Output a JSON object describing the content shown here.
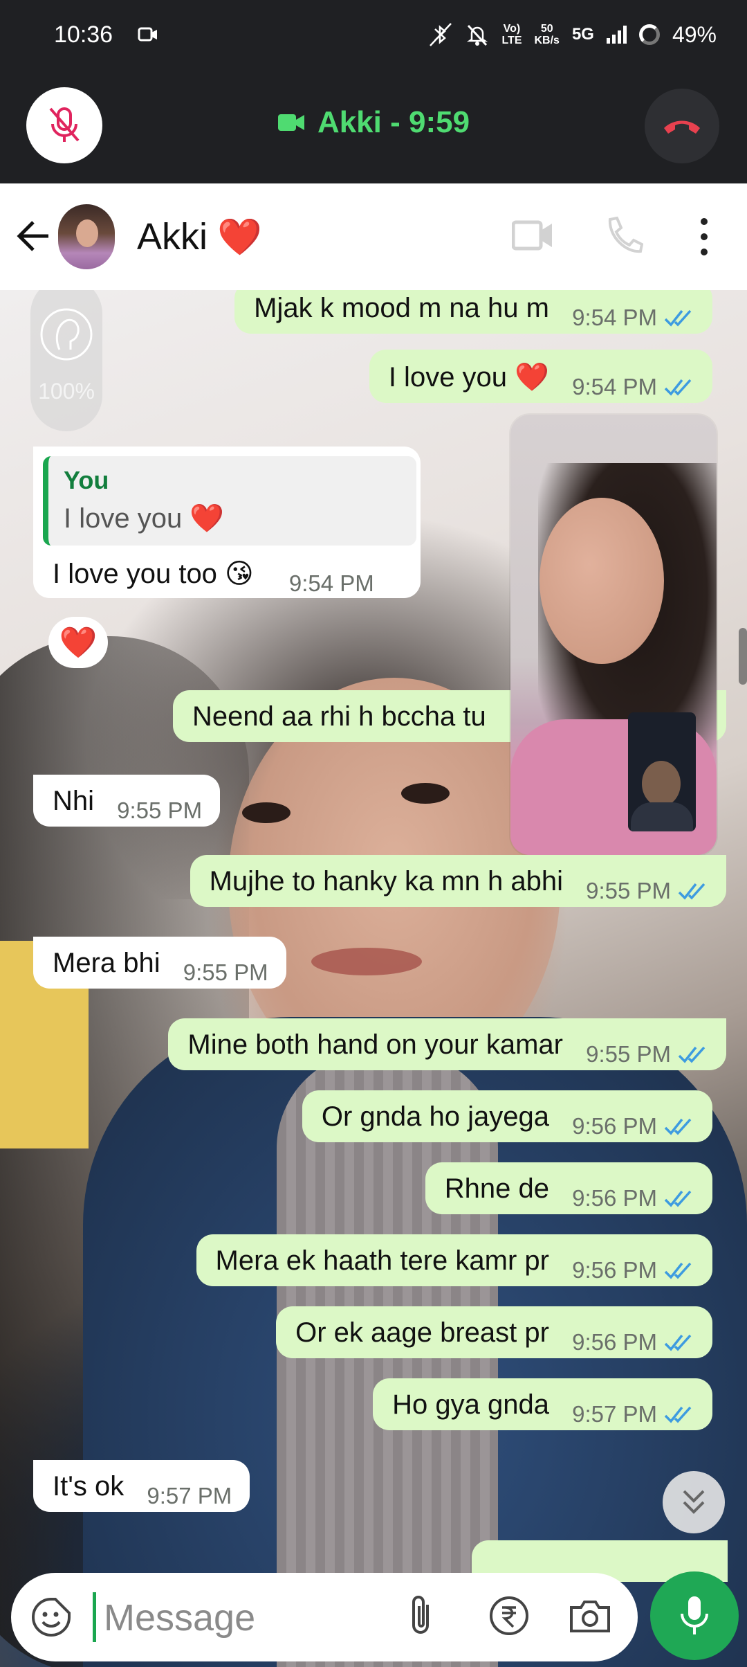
{
  "status_bar": {
    "time": "10:36",
    "net_speed_value": "50",
    "net_speed_unit": "KB/s",
    "volte_top": "Vo)",
    "volte_bottom": "LTE",
    "network": "5G",
    "battery": "49%"
  },
  "call_bar": {
    "title": "Akki - 9:59"
  },
  "header": {
    "contact_name": "Akki",
    "name_emoji": "❤️"
  },
  "eye_comfort": {
    "level": "100%"
  },
  "messages": [
    {
      "dir": "out",
      "text": "Mjak k mood m na hu m",
      "time": "9:54 PM"
    },
    {
      "dir": "out",
      "text": "I love you ❤️",
      "time": "9:54 PM"
    },
    {
      "dir": "in",
      "quote_name": "You",
      "quote_text": "I love you ❤️",
      "text": "I love you too 😘",
      "time": "9:54 PM",
      "reaction": "❤️"
    },
    {
      "dir": "out",
      "text": "Neend aa rhi h bccha tu"
    },
    {
      "dir": "in",
      "text": "Nhi",
      "time": "9:55 PM"
    },
    {
      "dir": "out",
      "text": "Mujhe to hanky ka mn h abhi",
      "time": "9:55 PM"
    },
    {
      "dir": "in",
      "text": "Mera bhi",
      "time": "9:55 PM"
    },
    {
      "dir": "out",
      "text": "Mine both hand on your kamar",
      "time": "9:55 PM"
    },
    {
      "dir": "out",
      "text": "Or gnda ho jayega",
      "time": "9:56 PM"
    },
    {
      "dir": "out",
      "text": "Rhne de",
      "time": "9:56 PM"
    },
    {
      "dir": "out",
      "text": "Mera ek haath tere kamr pr",
      "time": "9:56 PM"
    },
    {
      "dir": "out",
      "text": "Or ek aage breast pr",
      "time": "9:56 PM"
    },
    {
      "dir": "out",
      "text": "Ho gya gnda",
      "time": "9:57 PM"
    },
    {
      "dir": "in",
      "text": "It's ok",
      "time": "9:57 PM"
    }
  ],
  "input": {
    "placeholder": "Message"
  },
  "colors": {
    "accent_green": "#1fa855",
    "outgoing_bubble": "#dcf8c6",
    "read_ticks": "#3d9be0",
    "call_title": "#4fdb71"
  },
  "icons": [
    "mic-off-icon",
    "video-icon",
    "end-call-icon",
    "back-arrow-icon",
    "video-call-icon",
    "voice-call-icon",
    "more-icon",
    "eye-comfort-icon",
    "double-chevron-down-icon",
    "sticker-icon",
    "attach-icon",
    "rupee-icon",
    "camera-icon",
    "mic-icon"
  ]
}
